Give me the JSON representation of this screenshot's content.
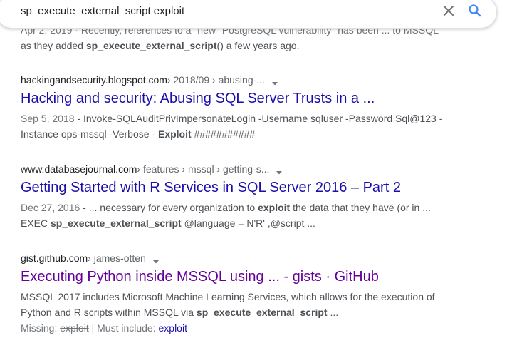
{
  "search": {
    "query": "sp_execute_external_script exploit"
  },
  "previous_result": {
    "date_line": "Apr 2, 2019 · Recently, references to a \"new\" PostgreSQL vulnerability\" has been ... to MSSQL",
    "snippet_a": "as they added ",
    "snippet_bold": "sp_execute_external_script",
    "snippet_b": "() a few years ago."
  },
  "results": [
    {
      "domain": "hackingandsecurity.blogspot.com",
      "path": " › 2018/09 › abusing-...",
      "title": "Hacking and security: Abusing SQL Server Trusts in a ...",
      "line1_date": "Sep 5, 2018",
      "line1_text": " - Invoke-SQLAuditPrivImpersonateLogin -Username sqluser -Password Sql@123 -",
      "line2_a": "Instance ops-mssql -Verbose - ",
      "line2_bold": "Exploit",
      "line2_b": " ###########"
    },
    {
      "domain": "www.databasejournal.com",
      "path": " › features › mssql › getting-s...",
      "title": "Getting Started with R Services in SQL Server 2016 – Part 2",
      "line1_date": "Dec 27, 2016",
      "line1_a": " - ... necessary for every organization to ",
      "line1_bold": "exploit",
      "line1_b": " the data that they have (or in ...",
      "line2_a": "EXEC ",
      "line2_bold": "sp_execute_external_script",
      "line2_b": " @language = N'R' ,@script ..."
    },
    {
      "domain": "gist.github.com",
      "path": " › james-otten",
      "title": "Executing Python inside MSSQL using ... - gists · GitHub",
      "line1": "MSSQL 2017 includes Microsoft Machine Learning Services, which allows for the execution of",
      "line2_a": "Python and R scripts within MSSQL via ",
      "line2_bold": "sp_execute_external_script",
      "line2_b": "  ...",
      "missing_label": "Missing: ",
      "missing_term": "exploit",
      "must_include_label": " | Must include: ",
      "must_include_term": "exploit"
    }
  ],
  "colors": {
    "link": "#1a0dab",
    "visited": "#660099",
    "search_icon": "#4285f4"
  },
  "icons": {
    "clear": "close-icon",
    "search": "search-icon",
    "menu": "caret-down-icon"
  }
}
